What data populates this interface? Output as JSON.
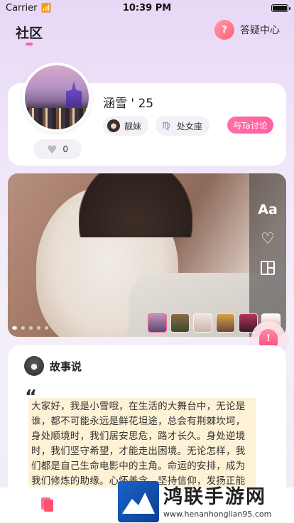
{
  "status": {
    "carrier": "Carrier",
    "time": "10:39 PM"
  },
  "header": {
    "title": "社区",
    "help_label": "答疑中心"
  },
  "profile": {
    "name": "涵雪 ' 25",
    "tags": [
      "靓妹",
      "处女座"
    ],
    "discuss_label": "与Ta讨论",
    "likes": "0"
  },
  "photo": {
    "text_tool": "Aa",
    "dots_count": 5,
    "thumbnails": 6
  },
  "story": {
    "title": "故事说",
    "body": "大家好，我是小雪哦，在生活的大舞台中，无论是谁，都不可能永远是鲜花坦途，总会有荆棘坎坷，身处顺境时，我们居安思危，路才长久。身处逆境时，我们坚守希望，才能走出困境。无论怎样，我们都是自己生命电影中的主角。命运的安排，成为我们修炼的助缘。心怀善念，坚持信仰，发扬正能量，感恩身边人..."
  },
  "watermark": {
    "title": "鸿联手游网",
    "url": "www.henanhonglian95.com"
  },
  "colors": {
    "accent": "#ff5fa0",
    "story_bg": "#fdf2d6"
  }
}
